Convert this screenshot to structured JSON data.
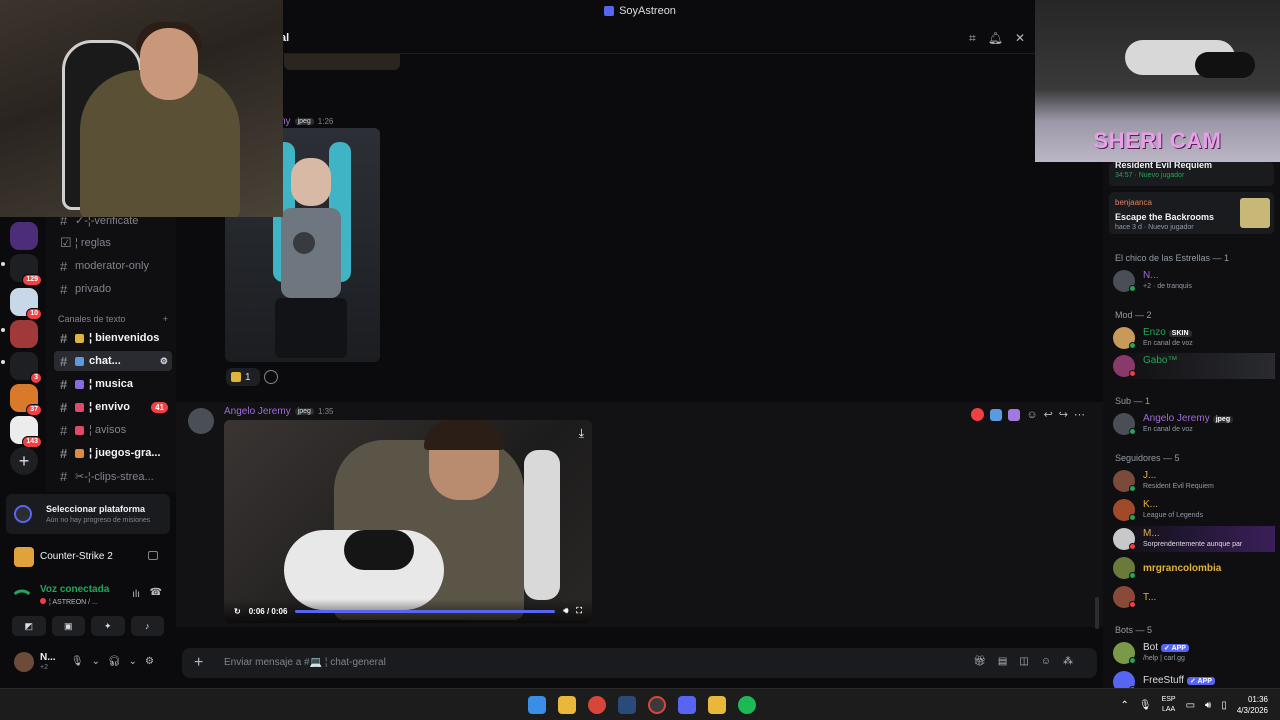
{
  "window": {
    "title": "SoyAstreon"
  },
  "header": {
    "channel_partial": "al"
  },
  "server_badges": [
    "129",
    "10",
    "3",
    "37",
    "143"
  ],
  "channels": {
    "items": [
      {
        "label": "✓-¦-verificate",
        "bright": false
      },
      {
        "label": "¦ reglas",
        "bright": false
      },
      {
        "label": "moderator-only",
        "bright": false
      },
      {
        "label": "privado",
        "bright": false
      }
    ],
    "category": "Canales de texto",
    "text_channels": [
      {
        "label": "¦ bienvenidos",
        "bright": true,
        "badge": ""
      },
      {
        "label": "chat...",
        "bright": true,
        "badge": ""
      },
      {
        "label": "¦ musica",
        "bright": true,
        "badge": ""
      },
      {
        "label": "¦ envivo",
        "bright": true,
        "badge": "41"
      },
      {
        "label": "¦ avisos",
        "bright": false,
        "badge": ""
      },
      {
        "label": "¦ juegos-gra...",
        "bright": true,
        "badge": ""
      },
      {
        "label": "✂-¦-clips-strea...",
        "bright": false,
        "badge": ""
      }
    ]
  },
  "quest": {
    "title": "Seleccionar plataforma",
    "subtitle": "Aún no hay progreso de misiones"
  },
  "game": {
    "name": "Counter-Strike 2"
  },
  "voice": {
    "status": "Voz conectada",
    "channel": "¦ ASTREON / ..."
  },
  "user": {
    "name": "N...",
    "status": "+2"
  },
  "webcam": {
    "label": "SHERI CAM"
  },
  "messages": {
    "first": {
      "author_partial": "ny",
      "tag": "jpeg",
      "time": "1:26",
      "reaction_count": "1"
    },
    "second": {
      "author": "Angelo Jeremy",
      "tag": "jpeg",
      "time": "1:35",
      "video_time": "0:06 / 0:06",
      "progress": 1.0
    }
  },
  "composer": {
    "placeholder": "Enviar mensaje a #💻 ¦ chat-general"
  },
  "members": {
    "top_cards": [
      {
        "game": "Resident Evil Requiem",
        "meta": "34:57 · Nuevo jugador"
      },
      {
        "user": "benjaanca",
        "game": "Escape the Backrooms",
        "meta": "hace 3 d · Nuevo jugador"
      }
    ],
    "sections": [
      {
        "title": "El chico de las Estrellas — 1",
        "people": [
          {
            "name": "N...",
            "status": "+2 · de tranquis",
            "color": "#a06ad8",
            "state": "#23a55a"
          }
        ]
      },
      {
        "title": "Mod — 2",
        "people": [
          {
            "name": "Enzo",
            "tag": "SKIN",
            "status": "En canal de voz",
            "color": "#23a55a",
            "state": "#23a55a"
          },
          {
            "name": "Gabo™",
            "status": "",
            "color": "#23a55a",
            "state": "#f23f43"
          }
        ]
      },
      {
        "title": "Sub — 1",
        "people": [
          {
            "name": "Angelo Jeremy",
            "tag": "jpeg",
            "status": "En canal de voz",
            "color": "#a06ad8",
            "state": "#23a55a"
          }
        ]
      },
      {
        "title": "Seguidores — 5",
        "people": [
          {
            "name": "J...",
            "status": "Resident Evil Requiem",
            "color": "#e0b33b",
            "state": "#23a55a"
          },
          {
            "name": "K...",
            "status": "League of Legends",
            "color": "#e0b33b",
            "state": "#23a55a"
          },
          {
            "name": "M...",
            "status": "Sorprendentemente aunque par",
            "color": "#e0b33b",
            "state": "#f23f43"
          },
          {
            "name": "mrgrancolombia",
            "status": "",
            "color": "#e0b33b",
            "state": "#23a55a"
          },
          {
            "name": "T...",
            "status": "",
            "color": "#e0b33b",
            "state": "#f23f43"
          }
        ]
      },
      {
        "title": "Bots — 5",
        "people": [
          {
            "name": "Bot",
            "tag": "✓ APP",
            "status": "/help | carl.gg",
            "color": "#dbdee1",
            "state": "#23a55a"
          },
          {
            "name": "FreeStuff",
            "tag": "✓ APP",
            "status": "",
            "color": "#dbdee1",
            "state": "#23a55a"
          }
        ]
      }
    ]
  },
  "taskbar": {
    "lang": "ESP",
    "lang2": "LAA",
    "time": "01:36",
    "date": "4/3/2026"
  }
}
